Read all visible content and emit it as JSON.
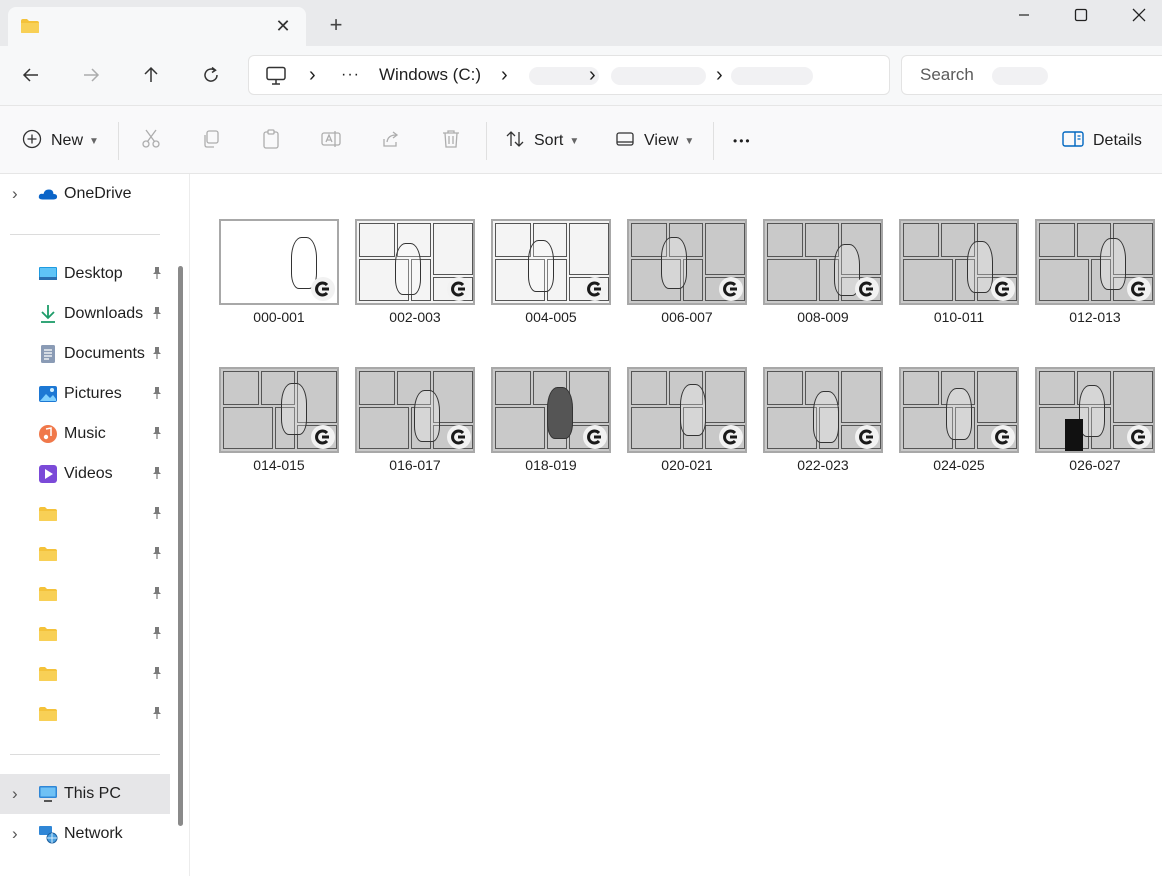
{
  "window": {
    "tab_close_glyph": "✕",
    "new_tab_glyph": "+"
  },
  "address": {
    "overflow_glyph": "···",
    "drive_label": "Windows (C:)",
    "separator_glyph": "›"
  },
  "search": {
    "placeholder": "Search"
  },
  "commands": {
    "new_label": "New",
    "sort_label": "Sort",
    "view_label": "View",
    "more_glyph": "•••",
    "details_label": "Details"
  },
  "sidebar": {
    "onedrive": "OneDrive",
    "pinned": [
      {
        "label": "Desktop",
        "icon": "desktop-icon"
      },
      {
        "label": "Downloads",
        "icon": "download-icon"
      },
      {
        "label": "Documents",
        "icon": "documents-icon"
      },
      {
        "label": "Pictures",
        "icon": "pictures-icon"
      },
      {
        "label": "Music",
        "icon": "music-icon"
      },
      {
        "label": "Videos",
        "icon": "videos-icon"
      },
      {
        "label": "",
        "icon": "folder-icon"
      },
      {
        "label": "",
        "icon": "folder-icon"
      },
      {
        "label": "",
        "icon": "folder-icon"
      },
      {
        "label": "",
        "icon": "folder-icon"
      },
      {
        "label": "",
        "icon": "folder-icon"
      },
      {
        "label": "",
        "icon": "folder-icon"
      }
    ],
    "this_pc": "This PC",
    "network": "Network",
    "pin_glyph": "📌",
    "expand_glyph": "›"
  },
  "files": [
    "000-001",
    "002-003",
    "004-005",
    "006-007",
    "008-009",
    "010-011",
    "012-013",
    "014-015",
    "016-017",
    "018-019",
    "020-021",
    "022-023",
    "024-025",
    "026-027"
  ],
  "colors": {
    "folder": "#f4c23a",
    "accent": "#0067c0",
    "onedrive": "#0a64c8"
  }
}
